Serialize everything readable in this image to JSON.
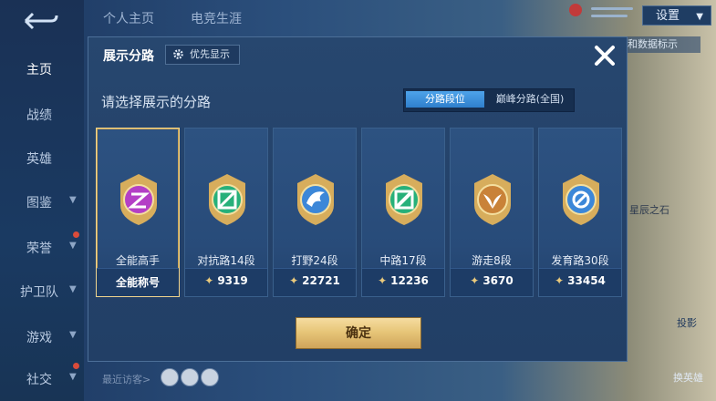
{
  "tabs": [
    "个人主页",
    "电竞生涯"
  ],
  "settings_label": "设置",
  "sidebar": {
    "items": [
      {
        "label": "主页",
        "active": true
      },
      {
        "label": "战绩"
      },
      {
        "label": "英雄"
      },
      {
        "label": "图鉴"
      },
      {
        "label": "荣誉"
      },
      {
        "label": "护卫队"
      },
      {
        "label": "游戏"
      },
      {
        "label": "社交"
      }
    ]
  },
  "background_peek": {
    "top_right": "和数据标示",
    "mid_right": "星辰之石",
    "lower_right": "投影",
    "bottom_right": "换英雄",
    "visitors": "最近访客>"
  },
  "modal": {
    "title": "展示分路",
    "priority_button": "优先显示",
    "subtitle": "请选择展示的分路",
    "toggle": {
      "active": "分路段位",
      "inactive": "巅峰分路(全国)"
    },
    "confirm": "确定",
    "cards": [
      {
        "name": "全能高手",
        "score": "全能称号",
        "selected": true,
        "color": "#b43fc6",
        "icon": "omni-emblem-icon"
      },
      {
        "name": "对抗路14段",
        "score": "9319",
        "color": "#27b07a",
        "icon": "clash-lane-emblem-icon"
      },
      {
        "name": "打野24段",
        "score": "22721",
        "color": "#3c87d8",
        "icon": "jungle-emblem-icon"
      },
      {
        "name": "中路17段",
        "score": "12236",
        "color": "#27b07a",
        "icon": "mid-lane-emblem-icon"
      },
      {
        "name": "游走8段",
        "score": "3670",
        "color": "#c98238",
        "icon": "roam-emblem-icon"
      },
      {
        "name": "发育路30段",
        "score": "33454",
        "color": "#3c87d8",
        "icon": "farm-lane-emblem-icon"
      }
    ]
  }
}
